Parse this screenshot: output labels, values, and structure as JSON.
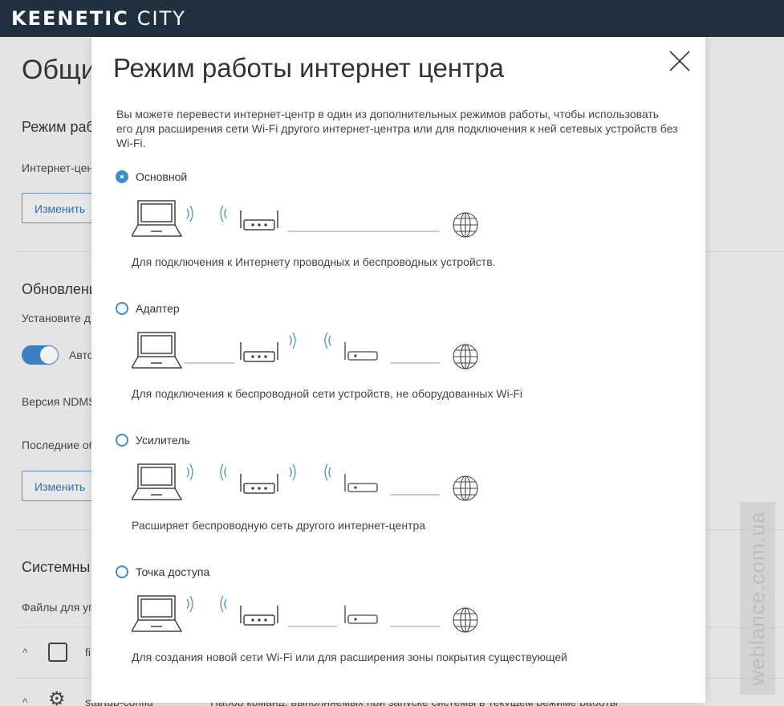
{
  "header": {
    "brand": "KEENETIC",
    "product": "CITY"
  },
  "background": {
    "page_title": "Общи",
    "mode_section": "Режим раб",
    "mode_text": "Интернет-цен",
    "change_button": "Изменить",
    "update_section": "Обновлени",
    "update_text": "Установите д",
    "auto_label": "Авто",
    "version_label": "Версия NDMS",
    "last_label": "Последние об",
    "change_button_2": "Изменить",
    "system_section": "Системны",
    "files_text": "Файлы для уп",
    "file1": "fi",
    "file2": "startup-config",
    "file2_desc": "Набор команд, выполняемых при запуске системы в текущем режиме работы"
  },
  "watermark": "weblance.com.ua",
  "modal": {
    "title": "Режим работы интернет центра",
    "intro": "Вы можете перевести интернет-центр в один из дополнительных режимов работы, чтобы использовать его для расширения сети Wi-Fi другого интернет-центра или для подключения к ней сетевых устройств без Wi-Fi.",
    "options": [
      {
        "label": "Основной",
        "description": "Для подключения к Интернету проводных и беспроводных устройств.",
        "selected": true
      },
      {
        "label": "Адаптер",
        "description": "Для подключения к беспроводной сети устройств, не оборудованных Wi-Fi",
        "selected": false
      },
      {
        "label": "Усилитель",
        "description": "Расширяет беспроводную сеть другого интернет-центра",
        "selected": false
      },
      {
        "label": "Точка доступа",
        "description": "Для создания новой сети Wi-Fi или для расширения зоны покрытия существующей",
        "selected": false
      }
    ]
  },
  "colors": {
    "accent": "#3d8ccb",
    "topbar": "#20303e",
    "icon_stroke": "#444444",
    "wave": "#4a90d6"
  }
}
